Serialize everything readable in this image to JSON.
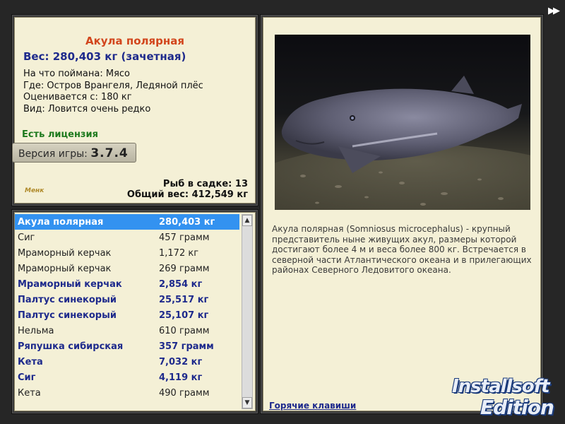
{
  "info": {
    "title": "Акула полярная",
    "weight": "Вес: 280,403 кг (зачетная)",
    "details": [
      "На что поймана: Мясо",
      "Где: Остров Врангеля, Ледяной плёс",
      "Оценивается с: 180 кг",
      "Вид: Ловится очень редко"
    ],
    "license": "Есть лицензия",
    "version_label": "Версия игры:",
    "version_number": "3.7.4",
    "logo_text": "Менк",
    "cage_count": "Рыб в садке: 13",
    "total_weight": "Общий вес: 412,549 кг"
  },
  "catch_list": [
    {
      "name": "Акула полярная",
      "weight": "280,403 кг",
      "style": "selected"
    },
    {
      "name": "Сиг",
      "weight": "457 грамм",
      "style": "normal"
    },
    {
      "name": "Мраморный керчак",
      "weight": "1,172 кг",
      "style": "normal"
    },
    {
      "name": "Мраморный керчак",
      "weight": "269 грамм",
      "style": "normal"
    },
    {
      "name": "Мраморный керчак",
      "weight": "2,854 кг",
      "style": "bold"
    },
    {
      "name": "Палтус синекорый",
      "weight": "25,517 кг",
      "style": "bold"
    },
    {
      "name": "Палтус синекорый",
      "weight": "25,107 кг",
      "style": "bold"
    },
    {
      "name": "Нельма",
      "weight": "610 грамм",
      "style": "normal"
    },
    {
      "name": "Ряпушка сибирская",
      "weight": "357 грамм",
      "style": "bold"
    },
    {
      "name": "Кета",
      "weight": "7,032 кг",
      "style": "bold"
    },
    {
      "name": "Сиг",
      "weight": "4,119 кг",
      "style": "bold"
    },
    {
      "name": "Кета",
      "weight": "490 грамм",
      "style": "normal"
    }
  ],
  "scroll": {
    "up_icon": "▲",
    "down_icon": "▼"
  },
  "description": "Акула полярная (Somniosus microcephalus) - крупный представитель ныне живущих акул, размеры которой достигают более 4 м и веса более 800 кг. Встречается в северной части Атлантического океана и в прилегающих районах Северного Ледовитого океана.",
  "hotkeys": "Горячие клавиши",
  "nav_arrow": "▶▶",
  "watermark": {
    "line1": "Installsoft",
    "line2": "Edition"
  },
  "colors": {
    "panel_bg": "#f4f0d6",
    "title": "#d2461d",
    "accent_blue": "#1e2a8c",
    "license_green": "#1e7a1e",
    "selected_row": "#3392f0"
  }
}
